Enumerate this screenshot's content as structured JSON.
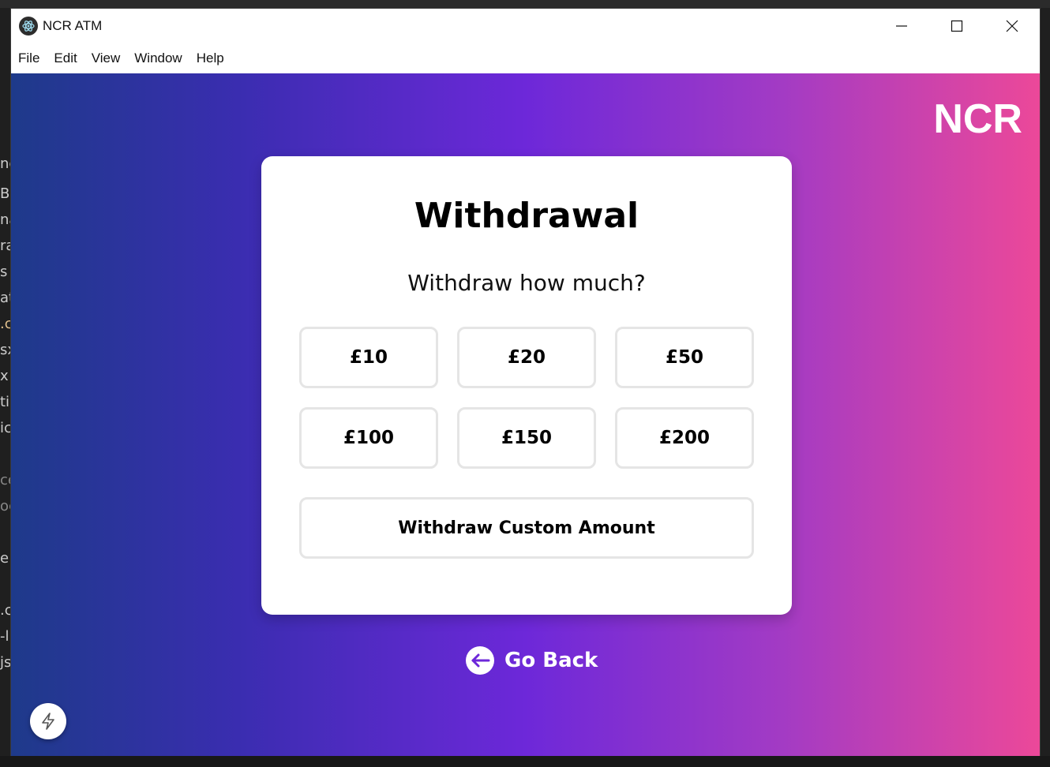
{
  "window": {
    "title": "NCR ATM",
    "controls": [
      "minimize-icon",
      "maximize-icon",
      "close-icon"
    ]
  },
  "menu": [
    "File",
    "Edit",
    "View",
    "Window",
    "Help"
  ],
  "brand": "NCR",
  "withdrawal": {
    "title": "Withdrawal",
    "prompt": "Withdraw how much?",
    "amounts": [
      "£10",
      "£20",
      "£50",
      "£100",
      "£150",
      "£200"
    ],
    "custom_label": "Withdraw Custom Amount"
  },
  "go_back": {
    "label": "Go Back",
    "icon": "arrow-left-circle-icon"
  },
  "dev_button_icon": "lightning-bolt-icon",
  "background_editor_fragments": [
    "ne",
    "Bu",
    "na",
    "ra",
    "s",
    "at",
    ".c",
    "sx",
    "x",
    "ti",
    "ic",
    "ce",
    "oc",
    "e",
    ".c",
    "-l",
    "js"
  ],
  "colors": {
    "gradient_start": "#1e3a8a",
    "gradient_mid": "#6d28d9",
    "gradient_end": "#ec4899",
    "card_bg": "#ffffff",
    "button_border": "#e5e5e5"
  }
}
